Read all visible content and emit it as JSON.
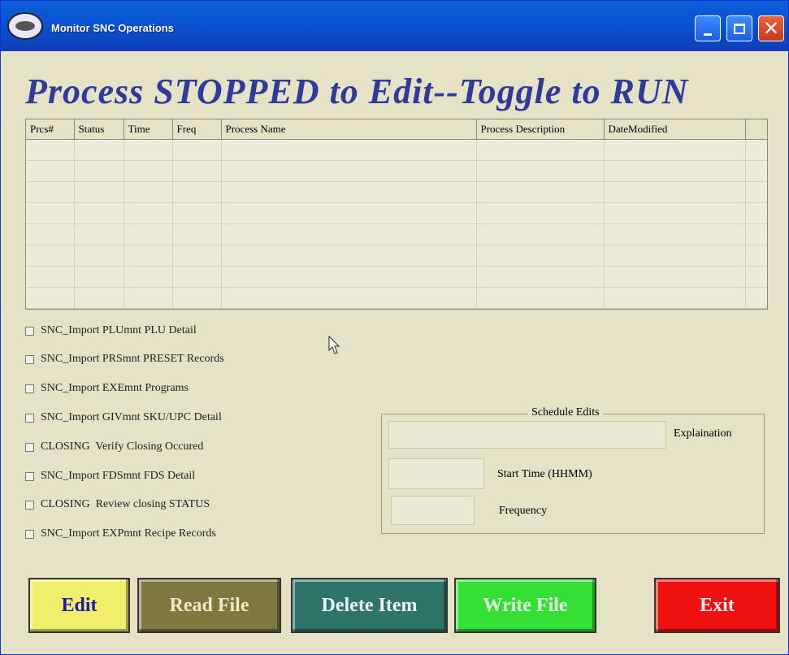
{
  "window": {
    "title": "Monitor SNC Operations",
    "controls": {
      "minimize": "minimize-icon",
      "maximize": "maximize-icon",
      "close": "close-icon"
    }
  },
  "heading": "Process STOPPED to Edit--Toggle to RUN",
  "process_table": {
    "columns": [
      "Prcs#",
      "Status",
      "Time",
      "Freq",
      "Process Name",
      "Process Description",
      "DateModified",
      ""
    ],
    "rows": []
  },
  "processes": [
    {
      "label": "SNC_Import PLUmnt PLU Detail",
      "checked": false
    },
    {
      "label": "SNC_Import PRSmnt PRESET Records",
      "checked": false
    },
    {
      "label": "SNC_Import EXEmnt Programs",
      "checked": false
    },
    {
      "label": "SNC_Import GIVmnt SKU/UPC Detail",
      "checked": false
    },
    {
      "label": "CLOSING  Verify Closing Occured",
      "checked": false
    },
    {
      "label": "SNC_Import FDSmnt FDS Detail",
      "checked": false
    },
    {
      "label": "CLOSING  Review closing STATUS",
      "checked": false
    },
    {
      "label": "SNC_Import EXPmnt Recipe Records",
      "checked": false
    }
  ],
  "schedule": {
    "title": "Schedule Edits",
    "explanation_label": "Explaination",
    "explanation_value": "",
    "start_time_label": "Start Time (HHMM)",
    "start_time_value": "",
    "frequency_label": "Frequency",
    "frequency_value": ""
  },
  "buttons": {
    "edit": "Edit",
    "read_file": "Read File",
    "delete_item": "Delete Item",
    "write_file": "Write File",
    "exit": "Exit"
  },
  "colors": {
    "heading": "#303a9c",
    "window_bg": "#e5e2c6",
    "edit": "#f0ee6a",
    "read_file": "#7d7840",
    "delete_item": "#2e7468",
    "write_file": "#34e034",
    "exit": "#f01010"
  }
}
